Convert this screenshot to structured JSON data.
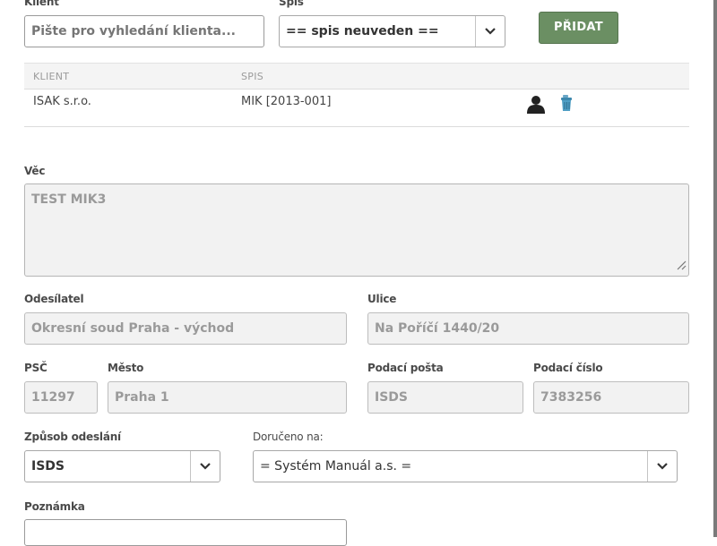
{
  "client": {
    "label": "Klient",
    "placeholder": "Pište pro vyhledání klienta..."
  },
  "file": {
    "label": "Spis",
    "selected": "== spis neuveden =="
  },
  "add_button": "PŘIDAT",
  "table": {
    "headers": [
      "KLIENT",
      "SPIS"
    ],
    "rows": [
      {
        "client": "ISAK s.r.o.",
        "file": "MIK [2013-001]"
      }
    ]
  },
  "subject": {
    "label": "Věc",
    "value": "TEST MIK3"
  },
  "sender": {
    "label": "Odesílatel",
    "value": "Okresní soud Praha - východ"
  },
  "street": {
    "label": "Ulice",
    "value": "Na Poříčí 1440/20"
  },
  "zip": {
    "label": "PSČ",
    "value": "11297"
  },
  "city": {
    "label": "Město",
    "value": "Praha 1"
  },
  "post_office": {
    "label": "Podací pošta",
    "value": "ISDS"
  },
  "post_number": {
    "label": "Podací číslo",
    "value": "7383256"
  },
  "delivery_method": {
    "label": "Způsob odeslání",
    "selected": "ISDS"
  },
  "delivered_to": {
    "label": "Doručeno na:",
    "selected": "= Systém Manuál a.s. ="
  },
  "note": {
    "label": "Poznámka",
    "value": ""
  },
  "colors": {
    "accent": "#6b8f63",
    "readonly_bg": "#f2f2f2",
    "border": "#b5b5b5"
  }
}
